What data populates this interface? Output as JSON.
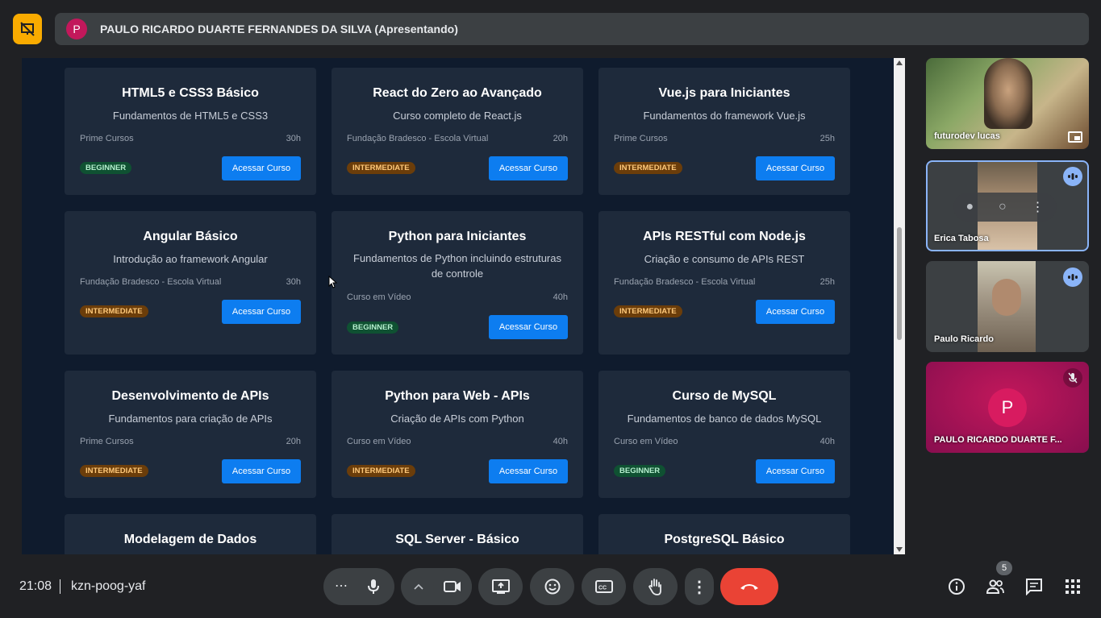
{
  "header": {
    "presenter_initial": "P",
    "presenter_label": "PAULO RICARDO DUARTE FERNANDES DA SILVA (Apresentando)",
    "icons": {
      "logo": "presentation-off-icon"
    }
  },
  "shared_screen": {
    "button_label": "Acessar Curso",
    "cards": [
      {
        "title": "HTML5 e CSS3 Básico",
        "desc": "Fundamentos de HTML5 e CSS3",
        "provider": "Prime Cursos",
        "hours": "30h",
        "level": "BEGINNER"
      },
      {
        "title": "React do Zero ao Avançado",
        "desc": "Curso completo de React.js",
        "provider": "Fundação Bradesco - Escola Virtual",
        "hours": "20h",
        "level": "INTERMEDIATE"
      },
      {
        "title": "Vue.js para Iniciantes",
        "desc": "Fundamentos do framework Vue.js",
        "provider": "Prime Cursos",
        "hours": "25h",
        "level": "INTERMEDIATE"
      },
      {
        "title": "Angular Básico",
        "desc": "Introdução ao framework Angular",
        "provider": "Fundação Bradesco - Escola Virtual",
        "hours": "30h",
        "level": "INTERMEDIATE"
      },
      {
        "title": "Python para Iniciantes",
        "desc": "Fundamentos de Python incluindo estruturas de controle",
        "provider": "Curso em Vídeo",
        "hours": "40h",
        "level": "BEGINNER"
      },
      {
        "title": "APIs RESTful com Node.js",
        "desc": "Criação e consumo de APIs REST",
        "provider": "Fundação Bradesco - Escola Virtual",
        "hours": "25h",
        "level": "INTERMEDIATE"
      },
      {
        "title": "Desenvolvimento de APIs",
        "desc": "Fundamentos para criação de APIs",
        "provider": "Prime Cursos",
        "hours": "20h",
        "level": "INTERMEDIATE"
      },
      {
        "title": "Python para Web - APIs",
        "desc": "Criação de APIs com Python",
        "provider": "Curso em Vídeo",
        "hours": "40h",
        "level": "INTERMEDIATE"
      },
      {
        "title": "Curso de MySQL",
        "desc": "Fundamentos de banco de dados MySQL",
        "provider": "Curso em Vídeo",
        "hours": "40h",
        "level": "BEGINNER"
      },
      {
        "title": "Modelagem de Dados"
      },
      {
        "title": "SQL Server - Básico"
      },
      {
        "title": "PostgreSQL Básico"
      }
    ]
  },
  "participants": [
    {
      "name": "futurodev lucas",
      "icon": "pip-icon"
    },
    {
      "name": "Erica Tabosa",
      "icon": "speaking-icon"
    },
    {
      "name": "Paulo Ricardo",
      "icon": "speaking-icon"
    },
    {
      "name": "PAULO RICARDO DUARTE F...",
      "initial": "P",
      "icon": "mic-off-icon"
    }
  ],
  "footer": {
    "time": "21:08",
    "meeting_code": "kzn-poog-yaf",
    "participants_count": "5",
    "controls": [
      "more-options-icon",
      "mic-icon",
      "chevron-up-icon",
      "camera-icon",
      "present-icon",
      "emoji-icon",
      "captions-icon",
      "raise-hand-icon",
      "more-vert-icon",
      "end-call-icon"
    ],
    "right_icons": [
      "info-icon",
      "people-icon",
      "chat-icon",
      "activities-icon"
    ]
  },
  "colors": {
    "end_call": "#ea4335",
    "accent_blue": "#0d7df0",
    "logo": "#f9ab00",
    "presenter_avatar": "#c2185b"
  }
}
